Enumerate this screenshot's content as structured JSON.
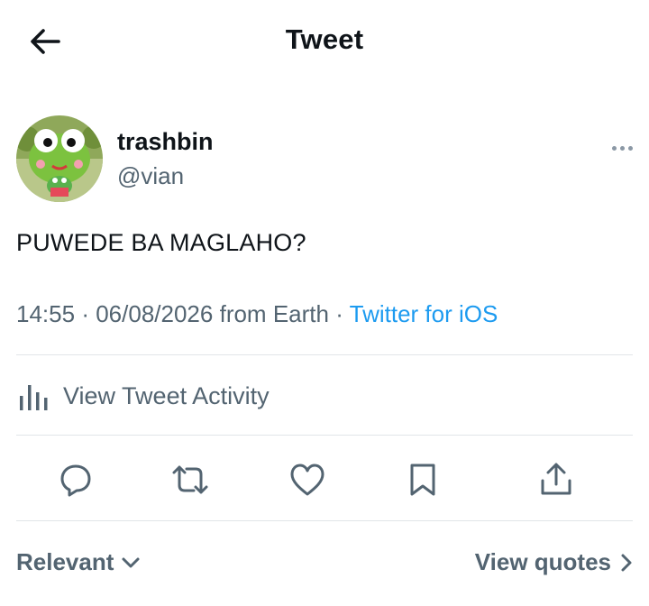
{
  "header": {
    "title": "Tweet",
    "back_icon": "arrow-left-icon"
  },
  "tweet": {
    "author": {
      "name": "trashbin",
      "handle": "@vian",
      "avatar_icon": "frog-avatar"
    },
    "text": "PUWEDE BA MAGLAHO?",
    "time": "14:55",
    "date": "06/08/2026",
    "location": "from Earth",
    "separator": "·",
    "source": "Twitter for iOS"
  },
  "activity": {
    "label": "View Tweet Activity",
    "icon": "bar-chart-icon"
  },
  "actions": [
    "reply-icon",
    "retweet-icon",
    "like-icon",
    "bookmark-icon",
    "share-icon"
  ],
  "footer": {
    "relevant": "Relevant",
    "view_quotes": "View quotes"
  },
  "colors": {
    "text": "#0f1419",
    "secondary": "#536471",
    "accent": "#1d9bf0",
    "divider": "#e1e5e8"
  }
}
